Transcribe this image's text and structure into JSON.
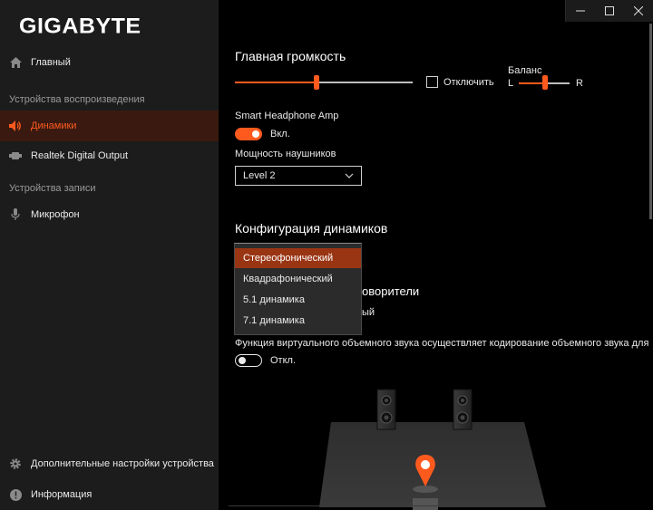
{
  "app": {
    "logo": "GIGABYTE"
  },
  "sidebar": {
    "home": "Главный",
    "playback_section": "Устройства воспроизведения",
    "speakers": "Динамики",
    "realtek": "Realtek Digital Output",
    "recording_section": "Устройства записи",
    "microphone": "Микрофон",
    "advanced": "Дополнительные настройки устройства",
    "info": "Информация"
  },
  "main": {
    "volume_title": "Главная громкость",
    "volume_level": 0.45,
    "mute_label": "Отключить",
    "balance_label": "Баланс",
    "balance_left": "L",
    "balance_right": "R",
    "balance_level": 0.55,
    "amp_label": "Smart Headphone Amp",
    "amp_toggle": "Вкл.",
    "headphone_power_label": "Мощность наушников",
    "headphone_power_value": "Level 2",
    "speaker_config_title": "Конфигурация динамиков",
    "speaker_config_options": [
      "Стереофонический",
      "Квадрафонический",
      "5.1 динамика",
      "7.1 динамика"
    ],
    "speaker_config_selected": "Стереофонический",
    "partial_heading": "оворители",
    "partial_checkbox_label": "ый",
    "virtual_surround_text": "Функция виртуального объемного звука осуществляет кодирование объемного звука для пере",
    "virtual_toggle": "Откл."
  },
  "colors": {
    "accent": "#ff5a1e",
    "sidebar_bg": "#1c1c1c",
    "active_bg": "#3a1a10",
    "dropdown_selected": "#9a3514"
  }
}
